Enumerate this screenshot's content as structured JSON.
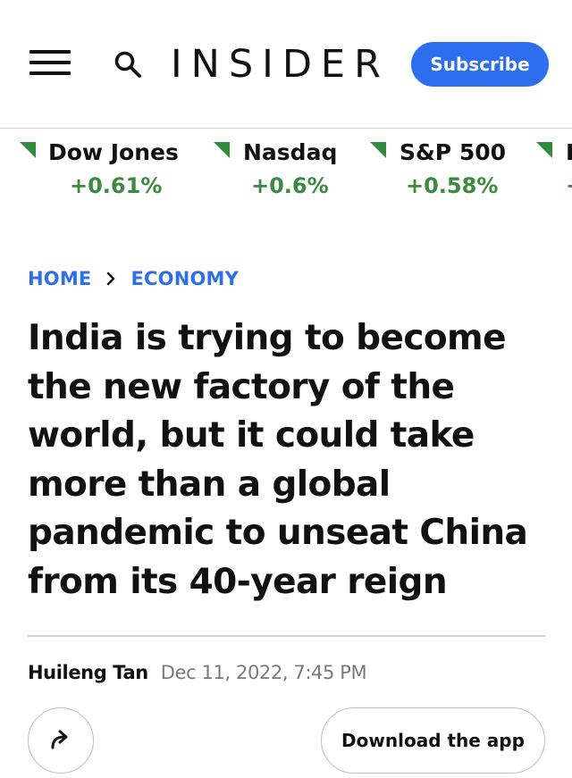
{
  "header": {
    "logo": "INSIDER",
    "subscribe_label": "Subscribe",
    "menu_icon": "hamburger-menu-icon",
    "search_icon": "search-icon",
    "accent_color": "#2d6ef0"
  },
  "ticker": {
    "up_color": "#3a8a3f",
    "items": [
      {
        "name": "Dow Jones",
        "change": "+0.61%"
      },
      {
        "name": "Nasdaq",
        "change": "+0.6%"
      },
      {
        "name": "S&P 500",
        "change": "+0.58%"
      },
      {
        "name": "I",
        "change": "+"
      }
    ]
  },
  "breadcrumb": {
    "home": "HOME",
    "section": "ECONOMY",
    "separator_icon": "chevron-right-icon"
  },
  "article": {
    "headline": "India is trying to become the new factory of the world, but it could take more than a global pandemic to unseat China from its 40-year reign",
    "author": "Huileng Tan",
    "date": "Dec 11, 2022, 7:45 PM"
  },
  "actions": {
    "share_icon": "share-arrow-icon",
    "download_label": "Download the app"
  }
}
